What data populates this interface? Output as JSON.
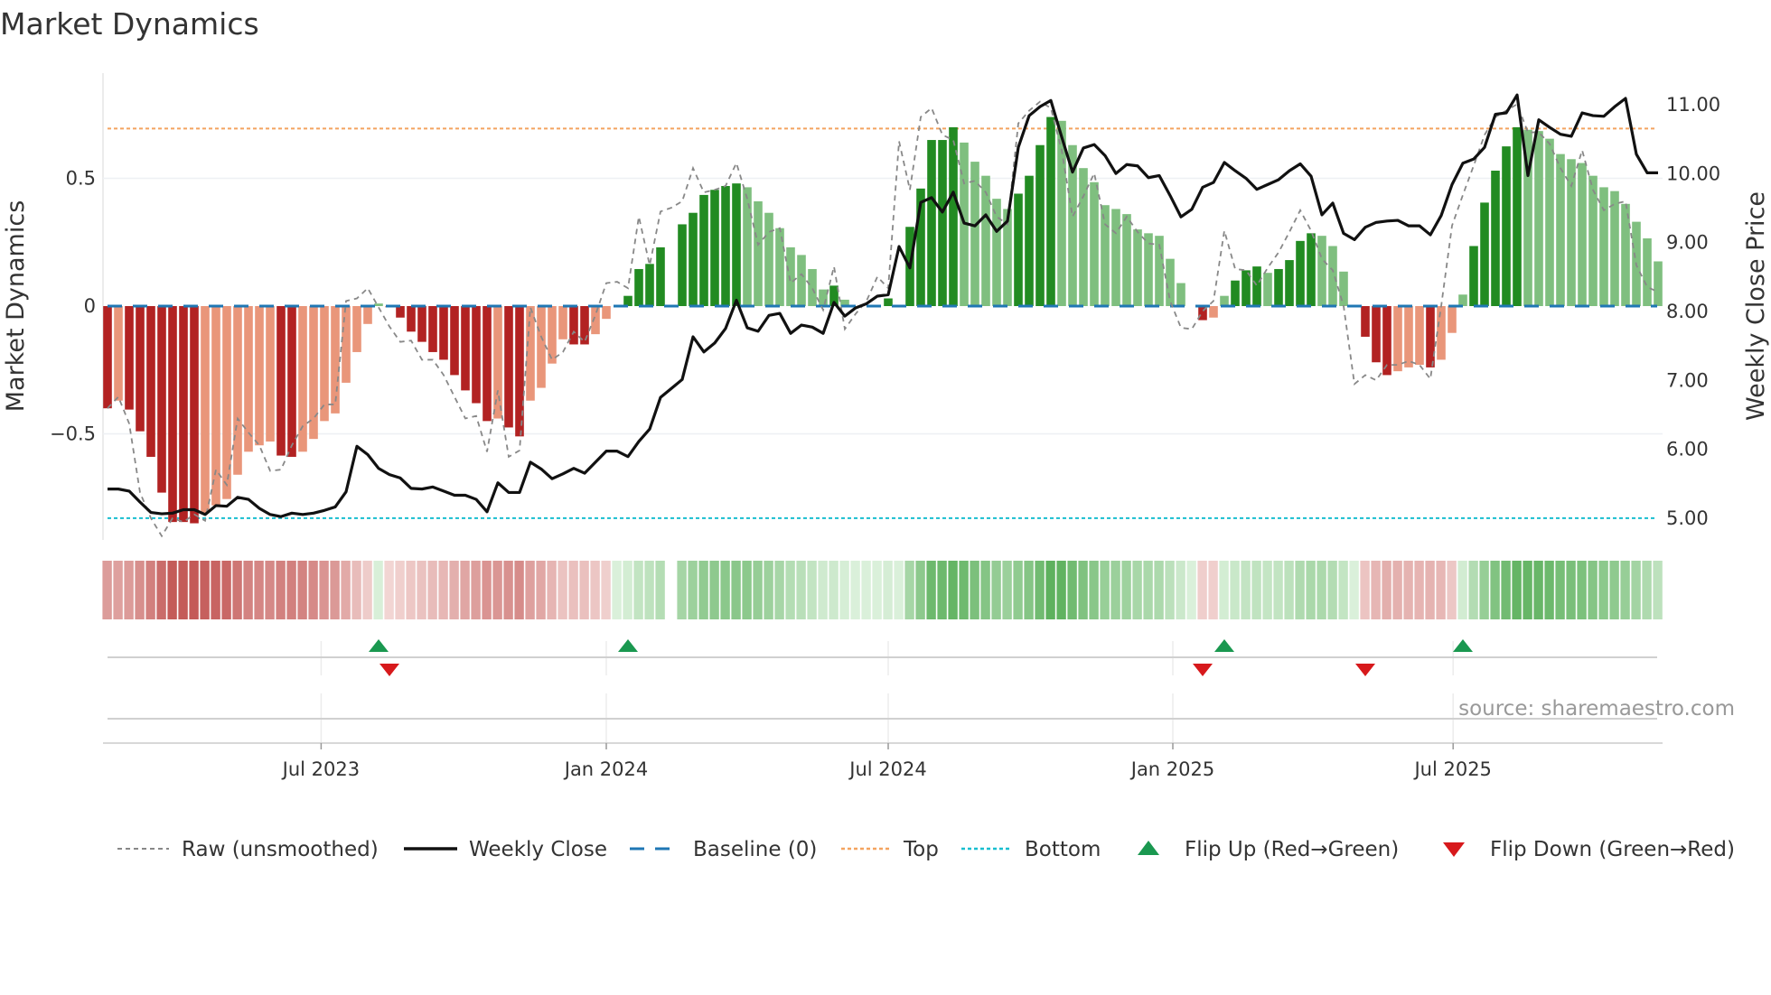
{
  "title": "Market Dynamics",
  "chart_data": {
    "type": "bar+line",
    "title": "Market Dynamics",
    "ylabel_left": "Market Dynamics",
    "ylabel_right": "Weekly Close Price",
    "ylim_left": [
      -0.93,
      0.92
    ],
    "ylim_right": [
      4.6,
      11.4
    ],
    "yticks_left": [
      {
        "v": 0.5,
        "label": "0.5"
      },
      {
        "v": 0,
        "label": "0"
      },
      {
        "v": -0.5,
        "label": "−0.5"
      }
    ],
    "yticks_right": [
      {
        "v": 11,
        "label": "11.00"
      },
      {
        "v": 10,
        "label": "10.00"
      },
      {
        "v": 9,
        "label": "9.00"
      },
      {
        "v": 8,
        "label": "8.00"
      },
      {
        "v": 7,
        "label": "7.00"
      },
      {
        "v": 6,
        "label": "6.00"
      },
      {
        "v": 5,
        "label": "5.00"
      }
    ],
    "xticks": [
      {
        "i": 19.7,
        "label": "Jul 2023"
      },
      {
        "i": 46.0,
        "label": "Jan 2024"
      },
      {
        "i": 72.0,
        "label": "Jul 2024"
      },
      {
        "i": 98.25,
        "label": "Jan 2025"
      },
      {
        "i": 124.1,
        "label": "Jul 2025"
      }
    ],
    "top_threshold": 0.695,
    "bottom_threshold": -0.83,
    "baseline": 0,
    "smoothed": [
      -0.4,
      -0.37,
      -0.405,
      -0.49,
      -0.59,
      -0.73,
      -0.845,
      -0.845,
      -0.85,
      -0.81,
      -0.78,
      -0.755,
      -0.66,
      -0.57,
      -0.545,
      -0.53,
      -0.585,
      -0.59,
      -0.57,
      -0.52,
      -0.45,
      -0.42,
      -0.3,
      -0.18,
      -0.07,
      0.01,
      -0.005,
      -0.045,
      -0.1,
      -0.14,
      -0.18,
      -0.21,
      -0.27,
      -0.33,
      -0.38,
      -0.45,
      -0.44,
      -0.475,
      -0.51,
      -0.37,
      -0.32,
      -0.225,
      -0.13,
      -0.15,
      -0.15,
      -0.11,
      -0.05,
      0.0,
      0.04,
      0.145,
      0.165,
      0.23,
      null,
      0.32,
      0.365,
      0.435,
      0.455,
      0.47,
      0.48,
      0.465,
      0.41,
      0.365,
      0.305,
      0.23,
      0.2,
      0.145,
      0.065,
      0.08,
      0.025,
      0.0,
      0.0,
      0.0,
      0.03,
      0.0,
      0.31,
      0.46,
      0.65,
      0.65,
      0.7,
      0.64,
      0.565,
      0.51,
      0.42,
      0.38,
      0.44,
      0.51,
      0.63,
      0.74,
      0.725,
      0.63,
      0.54,
      0.485,
      0.395,
      0.38,
      0.36,
      0.3,
      0.285,
      0.275,
      0.185,
      0.09,
      0.0,
      -0.055,
      -0.045,
      0.04,
      0.1,
      0.14,
      0.155,
      0.13,
      0.145,
      0.18,
      0.255,
      0.285,
      0.275,
      0.235,
      0.135,
      0.0,
      -0.12,
      -0.22,
      -0.27,
      -0.255,
      -0.24,
      -0.23,
      -0.24,
      -0.21,
      -0.105,
      0.045,
      0.235,
      0.405,
      0.53,
      0.625,
      0.7,
      0.69,
      0.685,
      0.655,
      0.595,
      0.575,
      0.56,
      0.51,
      0.465,
      0.45,
      0.4,
      0.33,
      0.265,
      0.175
    ],
    "raw": [
      -0.4,
      -0.355,
      -0.46,
      -0.73,
      -0.83,
      -0.9,
      -0.83,
      -0.845,
      -0.815,
      -0.84,
      -0.64,
      -0.7,
      -0.44,
      -0.495,
      -0.545,
      -0.645,
      -0.64,
      -0.545,
      -0.47,
      -0.44,
      -0.385,
      -0.385,
      0.02,
      0.03,
      0.07,
      -0.005,
      -0.08,
      -0.14,
      -0.135,
      -0.21,
      -0.21,
      -0.27,
      -0.355,
      -0.44,
      -0.43,
      -0.57,
      -0.33,
      -0.59,
      -0.565,
      -0.005,
      -0.12,
      -0.21,
      -0.18,
      -0.1,
      -0.14,
      -0.035,
      0.09,
      0.095,
      0.07,
      0.35,
      0.16,
      0.37,
      0.385,
      0.41,
      0.54,
      0.445,
      0.455,
      0.47,
      0.56,
      0.42,
      0.24,
      0.29,
      0.305,
      0.09,
      0.125,
      0.07,
      -0.015,
      0.155,
      -0.09,
      -0.03,
      0.02,
      0.115,
      0.07,
      0.645,
      0.455,
      0.74,
      0.775,
      0.67,
      0.65,
      0.48,
      0.49,
      0.445,
      0.35,
      0.32,
      0.715,
      0.765,
      0.8,
      0.775,
      0.61,
      0.35,
      0.43,
      0.52,
      0.32,
      0.285,
      0.35,
      0.29,
      0.245,
      0.24,
      0.02,
      -0.085,
      -0.09,
      -0.02,
      0.02,
      0.295,
      0.145,
      0.14,
      0.08,
      0.15,
      0.21,
      0.29,
      0.375,
      0.295,
      0.185,
      0.14,
      0.0,
      -0.305,
      -0.27,
      -0.29,
      -0.23,
      -0.23,
      -0.215,
      -0.23,
      -0.285,
      0.0,
      0.315,
      0.435,
      0.55,
      0.67,
      0.74,
      0.765,
      0.79,
      0.68,
      0.68,
      0.635,
      0.54,
      0.47,
      0.61,
      0.455,
      0.375,
      0.4,
      0.41,
      0.16,
      0.075,
      0.055
    ],
    "weekly_close": [
      5.41,
      5.41,
      5.38,
      5.22,
      5.07,
      5.05,
      5.06,
      5.11,
      5.11,
      5.04,
      5.17,
      5.16,
      5.29,
      5.26,
      5.13,
      5.04,
      5.01,
      5.06,
      5.04,
      5.06,
      5.1,
      5.15,
      5.37,
      6.03,
      5.91,
      5.71,
      5.62,
      5.57,
      5.42,
      5.41,
      5.44,
      5.38,
      5.32,
      5.32,
      5.26,
      5.08,
      5.5,
      5.36,
      5.36,
      5.8,
      5.7,
      5.56,
      5.63,
      5.71,
      5.64,
      5.8,
      5.96,
      5.96,
      5.88,
      6.1,
      6.28,
      6.74,
      6.87,
      7.0,
      7.62,
      7.4,
      7.53,
      7.74,
      8.15,
      7.75,
      7.7,
      7.93,
      7.96,
      7.67,
      7.79,
      7.76,
      7.67,
      8.12,
      7.92,
      8.04,
      8.1,
      8.21,
      8.23,
      8.93,
      8.62,
      9.57,
      9.64,
      9.43,
      9.72,
      9.27,
      9.23,
      9.39,
      9.15,
      9.3,
      10.37,
      10.83,
      10.96,
      11.05,
      10.52,
      10.01,
      10.36,
      10.41,
      10.25,
      9.99,
      10.12,
      10.1,
      9.93,
      9.96,
      9.67,
      9.36,
      9.47,
      9.79,
      9.86,
      10.15,
      10.03,
      9.92,
      9.76,
      9.83,
      9.9,
      10.03,
      10.13,
      9.95,
      9.39,
      9.56,
      9.12,
      9.03,
      9.21,
      9.28,
      9.3,
      9.31,
      9.23,
      9.23,
      9.1,
      9.38,
      9.83,
      10.14,
      10.2,
      10.37,
      10.85,
      10.87,
      11.13,
      9.96,
      10.77,
      10.66,
      10.56,
      10.53,
      10.87,
      10.83,
      10.82,
      10.96,
      11.08,
      10.27,
      10.0,
      10.0
    ],
    "flip_up": [
      25,
      48,
      103,
      125
    ],
    "flip_down": [
      26,
      101,
      116
    ],
    "colors": {
      "red_strong": "#b22222",
      "red_weak": "#e9967a",
      "green_strong": "#228b22",
      "green_weak": "#7fbf7f",
      "close": "#111111",
      "raw": "#888888",
      "baseline": "#1f77b4",
      "top": "#f4a460",
      "bottom": "#17becf",
      "flip_up": "#1a9850",
      "flip_down": "#d7191c"
    },
    "legend": {
      "placement": "bottom",
      "items": [
        {
          "label": "Raw (unsmoothed)",
          "style": "dashed-gray"
        },
        {
          "label": "Weekly Close",
          "style": "solid-black"
        },
        {
          "label": "Baseline (0)",
          "style": "dashed-blue"
        },
        {
          "label": "Top",
          "style": "dotted-orange"
        },
        {
          "label": "Bottom",
          "style": "dotted-cyan"
        },
        {
          "label": "Flip Up (Red→Green)",
          "style": "triangle-up-green"
        },
        {
          "label": "Flip Down (Green→Red)",
          "style": "triangle-down-red"
        }
      ]
    }
  },
  "source": "source: sharemaestro.com"
}
